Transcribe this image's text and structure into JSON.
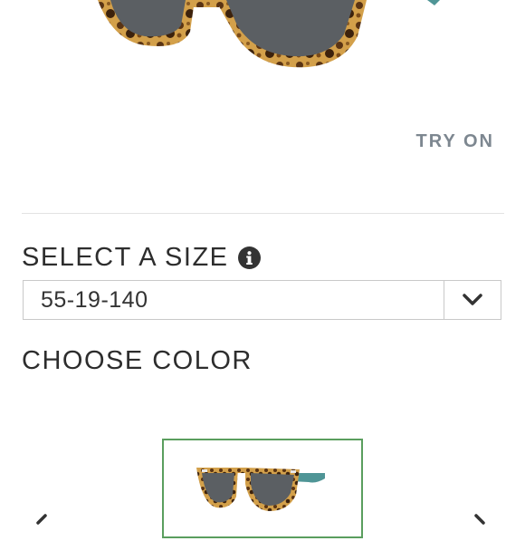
{
  "product": {
    "try_on_label": "TRY ON"
  },
  "size": {
    "heading": "SELECT A SIZE",
    "selected": "55-19-140"
  },
  "color": {
    "heading": "CHOOSE COLOR"
  },
  "icons": {
    "info": "info-icon",
    "dropdown": "chevron-down-icon",
    "prev": "chevron-left-icon",
    "next": "chevron-right-icon"
  },
  "colors": {
    "selected_border": "#5a9e5e",
    "try_on_text": "#7d8790",
    "heading_text": "#2d2d2d",
    "tortoise": "#c8922f",
    "lens": "#5b5f63",
    "temple": "#4f9596"
  }
}
